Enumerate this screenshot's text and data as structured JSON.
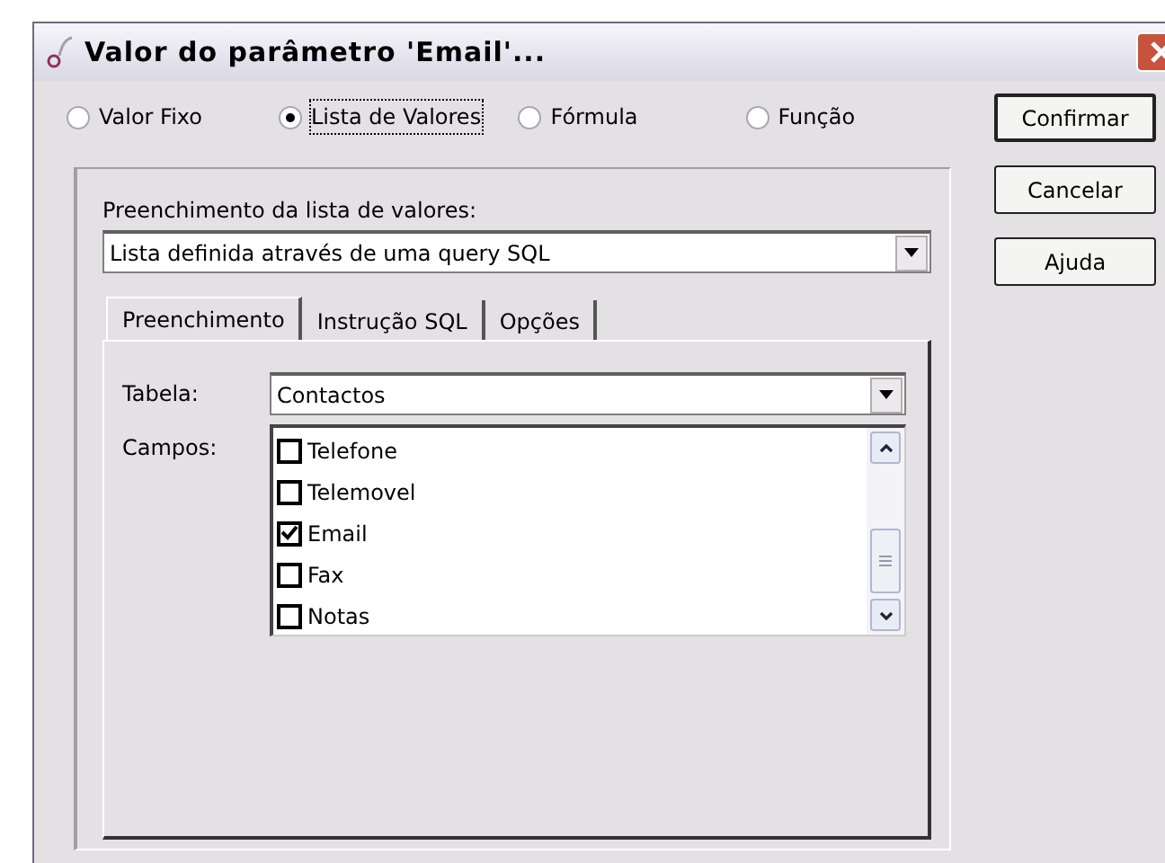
{
  "window": {
    "title": "Valor do parâmetro 'Email'..."
  },
  "value_types": [
    {
      "label": "Valor Fixo",
      "selected": false
    },
    {
      "label": "Lista de Valores",
      "selected": true
    },
    {
      "label": "Fórmula",
      "selected": false
    },
    {
      "label": "Função",
      "selected": false
    }
  ],
  "buttons": [
    "Confirmar",
    "Cancelar",
    "Ajuda"
  ],
  "fill_label": "Preenchimento da lista de valores:",
  "fill_combo": {
    "value": "Lista definida através de uma query SQL"
  },
  "tabs": [
    {
      "label": "Preenchimento",
      "selected": true
    },
    {
      "label": "Instrução SQL",
      "selected": false
    },
    {
      "label": "Opções",
      "selected": false
    }
  ],
  "table_label": "Tabela:",
  "table_combo": {
    "value": "Contactos"
  },
  "fields_label": "Campos:",
  "fields": [
    {
      "label": "Telefone",
      "checked": false
    },
    {
      "label": "Telemovel",
      "checked": false
    },
    {
      "label": "Email",
      "checked": true
    },
    {
      "label": "Fax",
      "checked": false
    },
    {
      "label": "Notas",
      "checked": false
    }
  ]
}
